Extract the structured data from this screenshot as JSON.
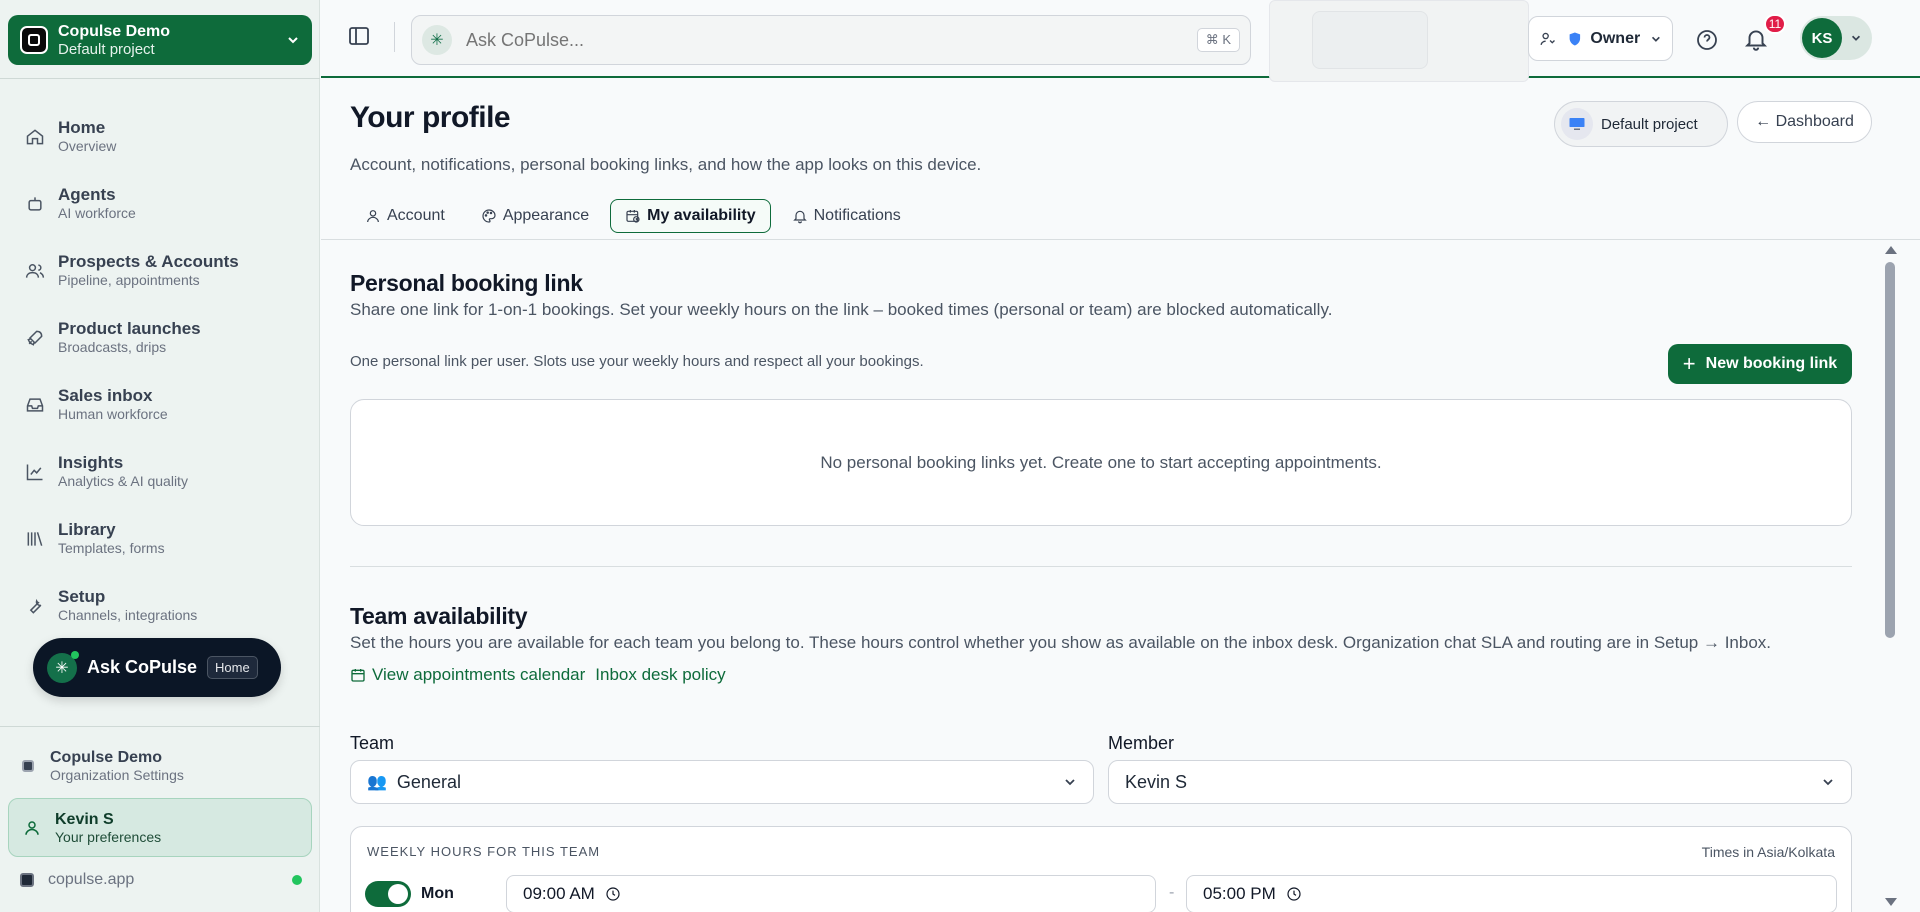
{
  "sidebar": {
    "project": {
      "name": "Copulse Demo",
      "sub": "Default project"
    },
    "items": [
      {
        "title": "Home",
        "sub": "Overview"
      },
      {
        "title": "Agents",
        "sub": "AI workforce"
      },
      {
        "title": "Prospects & Accounts",
        "sub": "Pipeline, appointments"
      },
      {
        "title": "Product launches",
        "sub": "Broadcasts, drips"
      },
      {
        "title": "Sales inbox",
        "sub": "Human workforce"
      },
      {
        "title": "Insights",
        "sub": "Analytics & AI quality"
      },
      {
        "title": "Library",
        "sub": "Templates, forms"
      },
      {
        "title": "Setup",
        "sub": "Channels, integrations"
      }
    ],
    "ask": {
      "label": "Ask CoPulse",
      "badge": "Home"
    },
    "org": {
      "title": "Copulse Demo",
      "sub": "Organization Settings"
    },
    "user": {
      "title": "Kevin S",
      "sub": "Your preferences"
    },
    "domain": "copulse.app"
  },
  "topbar": {
    "search_placeholder": "Ask CoPulse...",
    "shortcut": "⌘ K",
    "role": "Owner",
    "notif_count": "11",
    "avatar_initials": "KS"
  },
  "header": {
    "title": "Your profile",
    "subtitle": "Account, notifications, personal booking links, and how the app looks on this device.",
    "project_chip": "Default project",
    "dashboard_btn": "← Dashboard",
    "tabs": [
      {
        "label": "Account"
      },
      {
        "label": "Appearance"
      },
      {
        "label": "My availability",
        "active": true
      },
      {
        "label": "Notifications"
      }
    ]
  },
  "booking": {
    "title": "Personal booking link",
    "desc": "Share one link for 1-on-1 bookings. Set your weekly hours on the link – booked times (personal or team) are blocked automatically.",
    "note": "One personal link per user. Slots use your weekly hours and respect all your bookings.",
    "new_btn": "New booking link",
    "empty": "No personal booking links yet. Create one to start accepting appointments."
  },
  "team": {
    "title": "Team availability",
    "desc": "Set the hours you are available for each team you belong to. These hours control whether you show as available on the inbox desk. Organization chat SLA and routing are in Setup → Inbox.",
    "link_calendar": "View appointments calendar",
    "link_policy": "Inbox desk policy",
    "team_label": "Team",
    "team_value": "General",
    "member_label": "Member",
    "member_value": "Kevin S",
    "weekly_title": "WEEKLY HOURS FOR THIS TEAM",
    "timezone": "Times in Asia/Kolkata",
    "rows": [
      {
        "day": "Mon",
        "start": "09:00 AM",
        "end": "05:00 PM",
        "enabled": true
      }
    ],
    "separator": "-"
  },
  "colors": {
    "brand": "#0e6b3b",
    "badge": "#e11d48",
    "dark_pill": "#0b1626"
  }
}
